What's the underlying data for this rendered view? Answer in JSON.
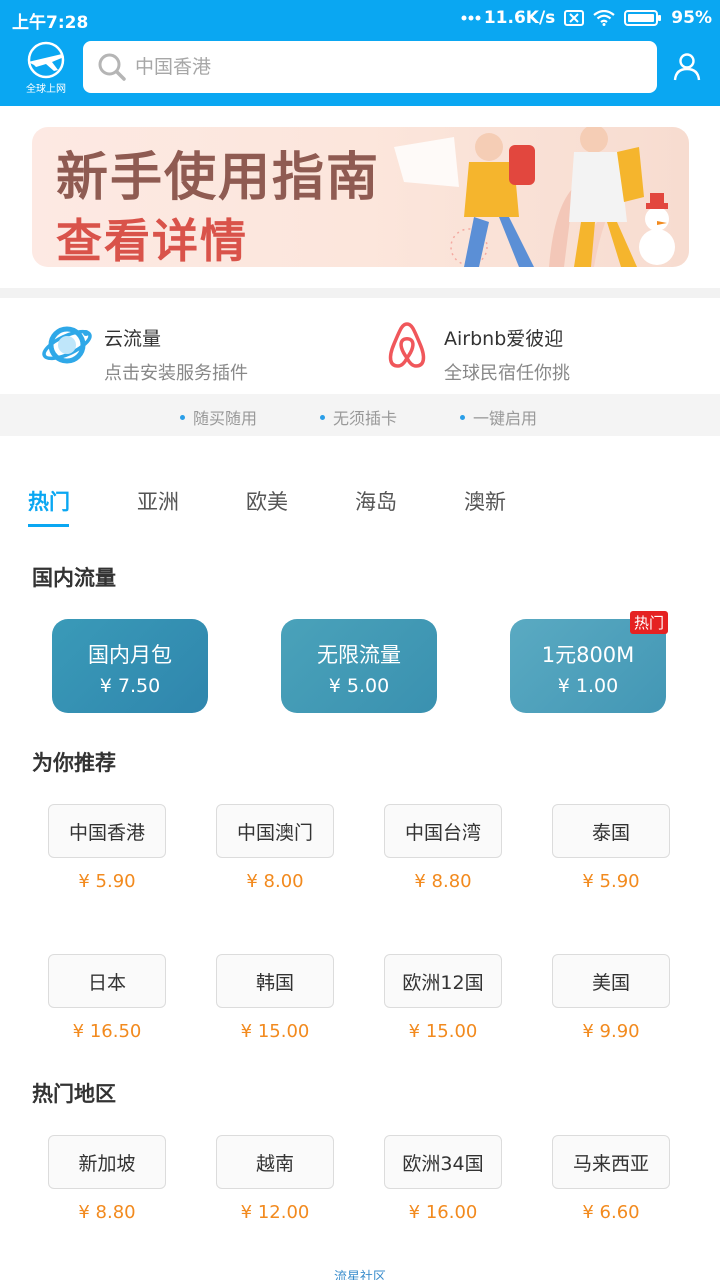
{
  "status_bar": {
    "time": "上午7:28",
    "speed": "11.6K/s",
    "battery": "95%",
    "icons": [
      "more-dots-icon",
      "sim-x-icon",
      "wifi-icon",
      "battery-icon"
    ]
  },
  "header": {
    "logo_label": "全球上网",
    "search_placeholder": "中国香港",
    "icons": [
      "plane-logo-icon",
      "search-icon",
      "user-icon"
    ]
  },
  "banner": {
    "line1": "新手使用指南",
    "line2": "查看详情"
  },
  "services": [
    {
      "name": "云流量",
      "desc": "点击安装服务插件",
      "icon": "planet-icon"
    },
    {
      "name": "Airbnb爱彼迎",
      "desc": "全球民宿任你挑",
      "icon": "airbnb-icon"
    }
  ],
  "features": [
    "随买随用",
    "无须插卡",
    "一键启用"
  ],
  "tabs": [
    "热门",
    "亚洲",
    "欧美",
    "海岛",
    "澳新"
  ],
  "active_tab": "热门",
  "domestic": {
    "title": "国内流量",
    "items": [
      {
        "name": "国内月包",
        "price": "¥ 7.50"
      },
      {
        "name": "无限流量",
        "price": "¥ 5.00"
      },
      {
        "name": "1元800M",
        "price": "¥ 1.00",
        "badge": "热门"
      }
    ]
  },
  "recommend": {
    "title": "为你推荐",
    "items": [
      {
        "name": "中国香港",
        "price": "¥ 5.90"
      },
      {
        "name": "中国澳门",
        "price": "¥ 8.00"
      },
      {
        "name": "中国台湾",
        "price": "¥ 8.80"
      },
      {
        "name": "泰国",
        "price": "¥ 5.90"
      },
      {
        "name": "日本",
        "price": "¥ 16.50"
      },
      {
        "name": "韩国",
        "price": "¥ 15.00"
      },
      {
        "name": "欧洲12国",
        "price": "¥ 15.00"
      },
      {
        "name": "美国",
        "price": "¥ 9.90"
      }
    ]
  },
  "hot_regions": {
    "title": "热门地区",
    "items": [
      {
        "name": "新加坡",
        "price": "¥ 8.80"
      },
      {
        "name": "越南",
        "price": "¥ 12.00"
      },
      {
        "name": "欧洲34国",
        "price": "¥ 16.00"
      },
      {
        "name": "马来西亚",
        "price": "¥ 6.60"
      }
    ]
  },
  "footer": {
    "label": "流星社区"
  },
  "colors": {
    "primary": "#0aa7f2",
    "price": "#f28a1e",
    "hot_badge": "#e52222",
    "card_teal": "#3a93b3"
  }
}
